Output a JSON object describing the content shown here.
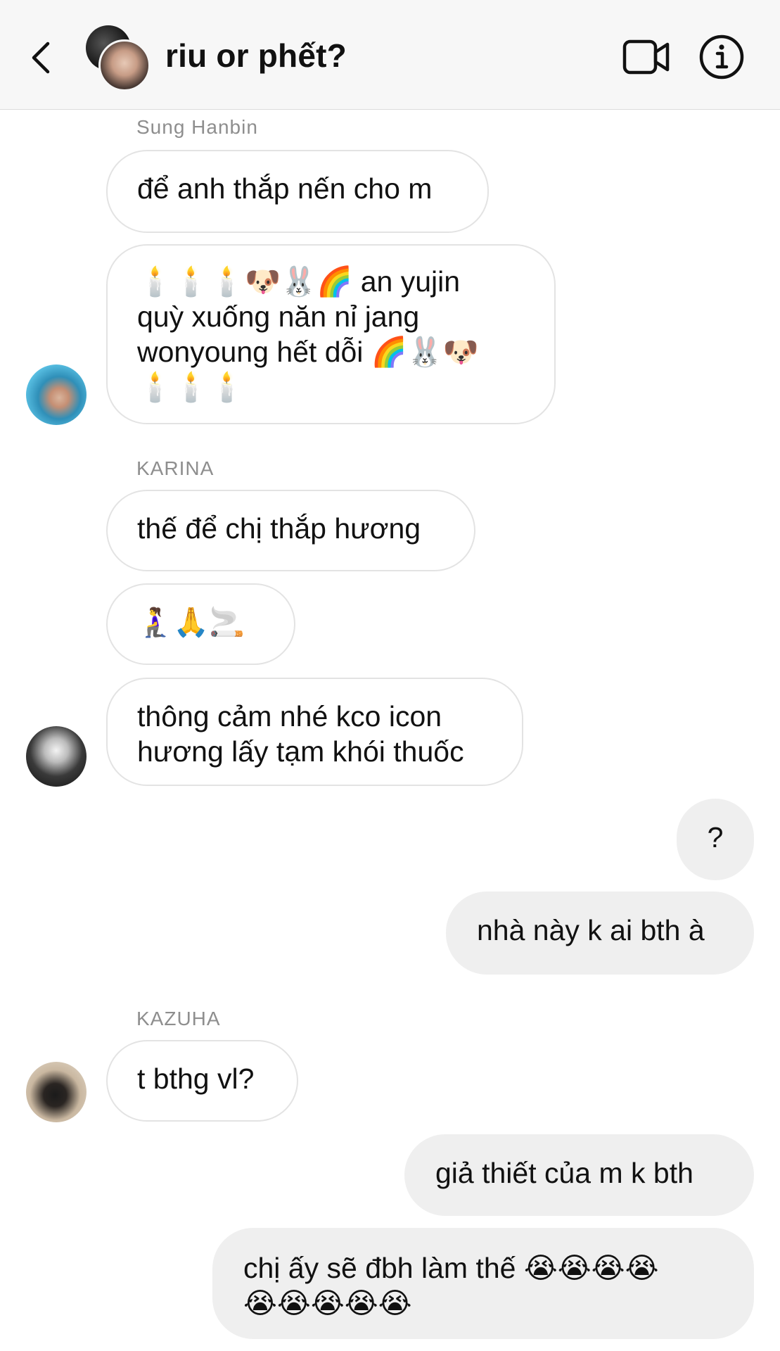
{
  "header": {
    "title": "riu or phết?",
    "back_icon": "chevron-left-icon",
    "video_icon": "video-camera-icon",
    "info_icon": "info-icon"
  },
  "messages": {
    "hanbin": {
      "sender": "Sung Hanbin",
      "bubble1": "để anh thắp nến cho m",
      "b2_line1_emoji": "🕯️🕯️🕯️🐶🐰🌈",
      "b2_line1_text": " an yujin",
      "b2_line2": "quỳ xuống năn nỉ jang",
      "b2_line3_text": "wonyoung hết dỗi ",
      "b2_line3_emoji": "🌈🐰🐶",
      "b2_line4_emoji": "🕯️🕯️🕯️"
    },
    "karina": {
      "sender": "KARINA",
      "bubble1": "thế để chị thắp hương",
      "bubble2_emoji": "🧎‍♀️🙏🚬",
      "bubble3_line1": "thông cảm nhé kco icon",
      "bubble3_line2": "hương lấy tạm khói thuốc"
    },
    "me1": {
      "bubble1": "?",
      "bubble2": "nhà này k ai bth à"
    },
    "kazuha": {
      "sender": "KAZUHA",
      "bubble1": "t bthg vl?"
    },
    "me2": {
      "bubble1": "giả thiết của m k bth",
      "bubble2_text": "chị ấy sẽ đbh làm thế ",
      "bubble2_emoji1": "😭😭😭😭",
      "bubble2_emoji2": "😭😭😭😭😭"
    }
  },
  "colors": {
    "header_bg": "#f7f7f7",
    "my_bubble_bg": "#efefef",
    "their_bubble_border": "#e3e3e3",
    "sender_label": "#8e8e8e"
  }
}
